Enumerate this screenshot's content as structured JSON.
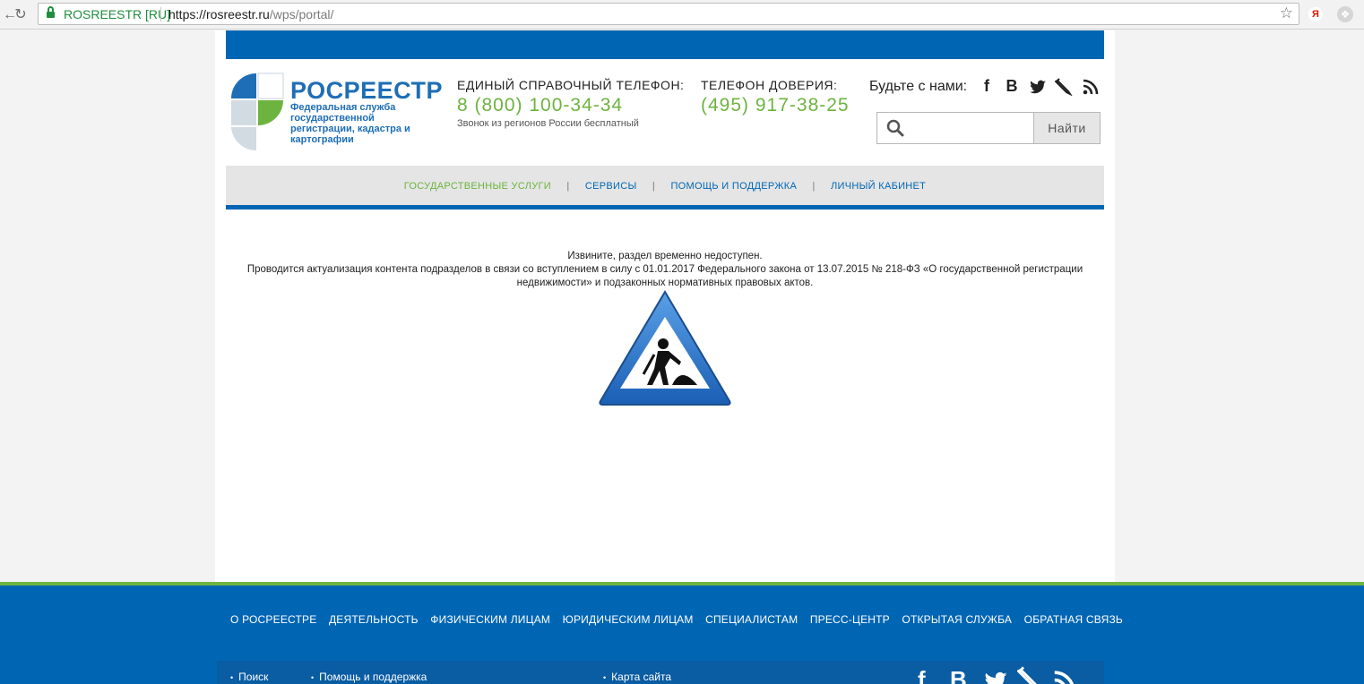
{
  "browser": {
    "site_identity": "ROSREESTR [RU]",
    "url_host": "https://rosreestr.ru",
    "url_path": "/wps/portal/",
    "ext_yandex": "Я"
  },
  "header": {
    "logo_title": "РОСРЕЕСТР",
    "logo_subtitle": "Федеральная служба государственной регистрации, кадастра и картографии",
    "hotline_label": "ЕДИНЫЙ СПРАВОЧНЫЙ ТЕЛЕФОН:",
    "hotline_number": "8 (800) 100-34-34",
    "hotline_note": "Звонок из регионов России бесплатный",
    "trust_label": "ТЕЛЕФОН ДОВЕРИЯ:",
    "trust_number": "(495) 917-38-25",
    "follow_label": "Будьте с нами:",
    "social": [
      "facebook-icon",
      "vk-icon",
      "twitter-icon",
      "livejournal-icon",
      "rss-icon"
    ],
    "search_placeholder": "",
    "search_button": "Найти"
  },
  "main_nav": {
    "items": [
      {
        "label": "ГОСУДАРСТВЕННЫЕ УСЛУГИ",
        "active": true
      },
      {
        "label": "СЕРВИСЫ",
        "active": false
      },
      {
        "label": "ПОМОЩЬ И ПОДДЕРЖКА",
        "active": false
      },
      {
        "label": "ЛИЧНЫЙ КАБИНЕТ",
        "active": false
      }
    ],
    "separator": "|"
  },
  "message": {
    "line1": "Извините, раздел временно недоступен.",
    "line2": "Проводится актуализация контента подразделов в связи со вступлением в силу с 01.01.2017 Федерального закона от 13.07.2015 № 218-ФЗ «О государственной регистрации недвижимости» и подзаконных нормативных правовых актов."
  },
  "footer": {
    "links": [
      "О РОСРЕЕСТРЕ",
      "ДЕЯТЕЛЬНОСТЬ",
      "ФИЗИЧЕСКИМ ЛИЦАМ",
      "ЮРИДИЧЕСКИМ ЛИЦАМ",
      "СПЕЦИАЛИСТАМ",
      "ПРЕСС-ЦЕНТР",
      "ОТКРЫТАЯ СЛУЖБА",
      "ОБРАТНАЯ СВЯЗЬ"
    ],
    "sub_links": [
      "Поиск",
      "Помощь и поддержка",
      "Карта сайта"
    ]
  },
  "colors": {
    "brand_blue": "#0066b3",
    "brand_green": "#6db33f"
  }
}
